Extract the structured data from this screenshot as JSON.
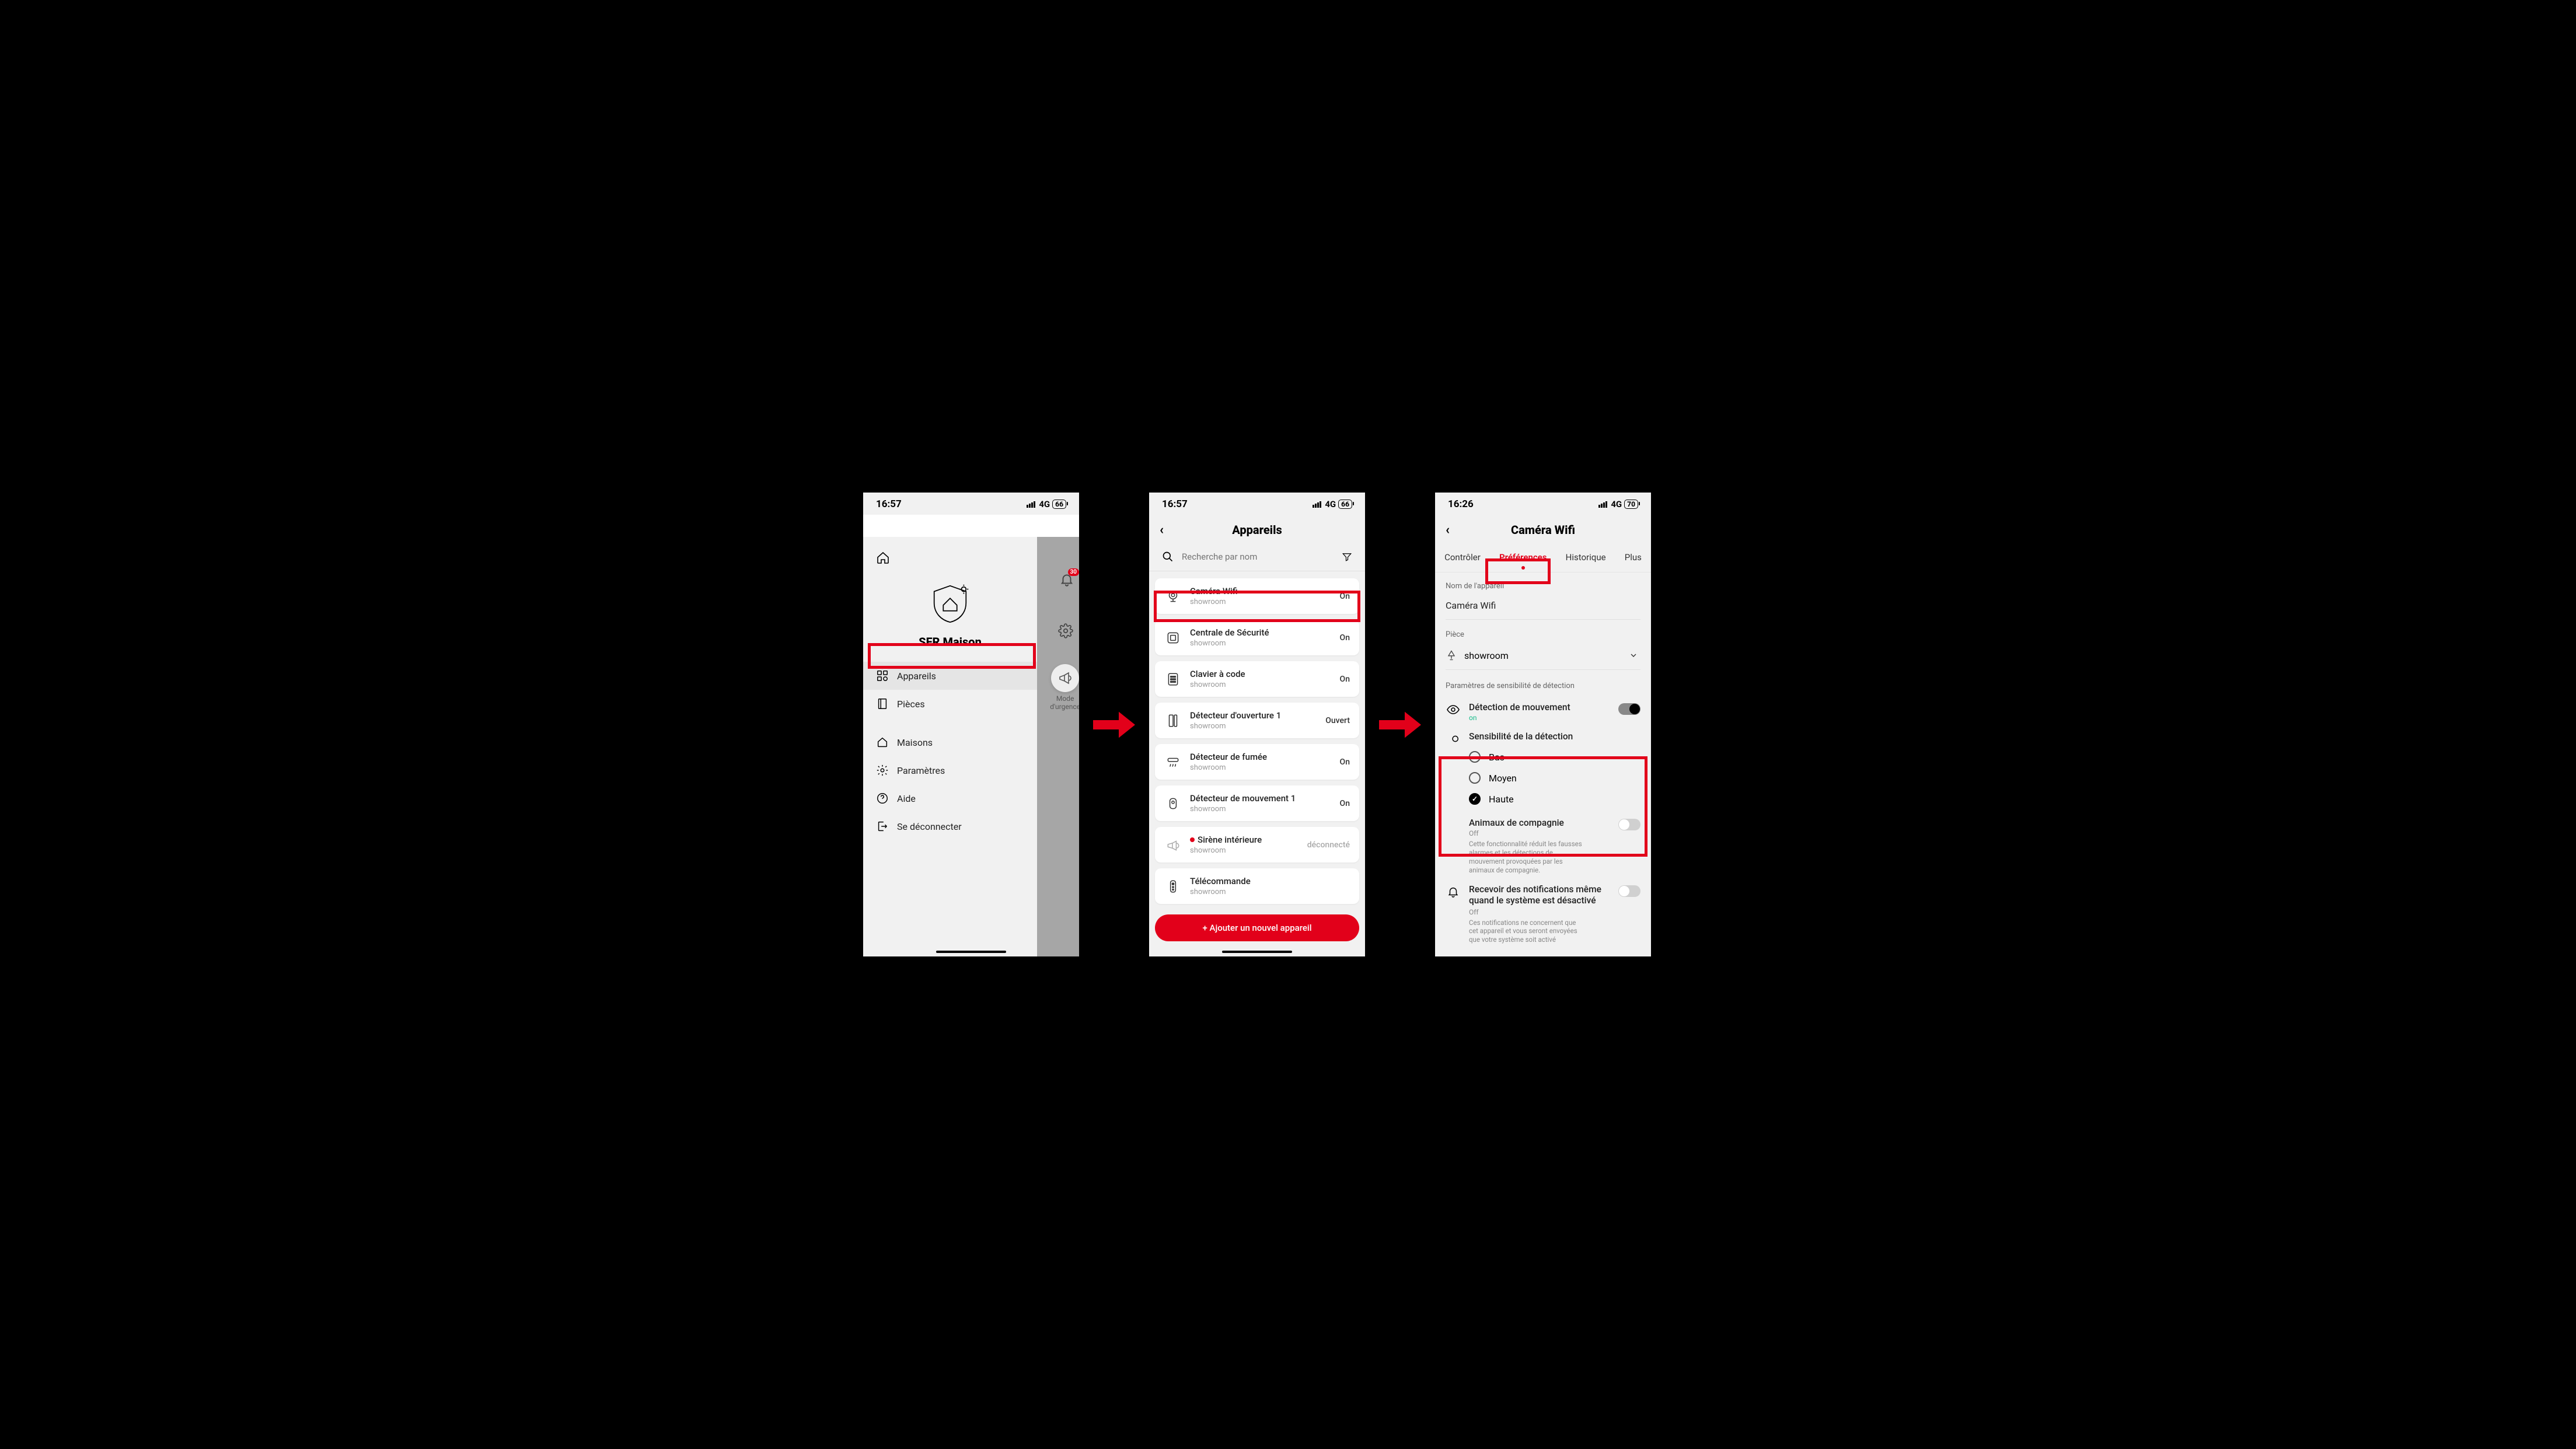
{
  "status": {
    "time1": "16:57",
    "time2": "16:57",
    "time3": "16:26",
    "net": "4G",
    "batt1": "66",
    "batt2": "66",
    "batt3": "70"
  },
  "screen1": {
    "title": "SFR Maison",
    "items": [
      {
        "label": "Appareils",
        "selected": true
      },
      {
        "label": "Pièces"
      },
      {
        "label": "Maisons"
      },
      {
        "label": "Paramètres"
      },
      {
        "label": "Aide"
      },
      {
        "label": "Se déconnecter"
      }
    ],
    "urgence": {
      "l1": "Mode",
      "l2": "d'urgence"
    },
    "badge": "30"
  },
  "screen2": {
    "title": "Appareils",
    "search_placeholder": "Recherche par nom",
    "add": "+ Ajouter un nouvel appareil",
    "devices": [
      {
        "name": "Caméra Wifi",
        "room": "showroom",
        "state": "On",
        "icon": "camera"
      },
      {
        "name": "Centrale de Sécurité",
        "room": "showroom",
        "state": "On",
        "icon": "hub"
      },
      {
        "name": "Clavier à code",
        "room": "showroom",
        "state": "On",
        "icon": "keypad"
      },
      {
        "name": "Détecteur d'ouverture 1",
        "room": "showroom",
        "state": "Ouvert",
        "icon": "door"
      },
      {
        "name": "Détecteur de fumée",
        "room": "showroom",
        "state": "On",
        "icon": "smoke"
      },
      {
        "name": "Détecteur de mouvement 1",
        "room": "showroom",
        "state": "On",
        "icon": "motion"
      },
      {
        "name": "Sirène intérieure",
        "room": "showroom",
        "state": "déconnecté",
        "disconnected": true,
        "icon": "siren",
        "dot": true
      },
      {
        "name": "Télécommande",
        "room": "showroom",
        "state": "",
        "icon": "remote"
      }
    ]
  },
  "screen3": {
    "title": "Caméra Wifi",
    "tabs": [
      "Contrôler",
      "Préférences",
      "Historique",
      "Plus"
    ],
    "active_tab": 1,
    "name_label": "Nom de l'appareil",
    "name_value": "Caméra Wifi",
    "room_label": "Pièce",
    "room_value": "showroom",
    "sens_section": "Paramètres de sensibilité de détection",
    "motion": {
      "title": "Détection de mouvement",
      "state": "on"
    },
    "sens": {
      "title": "Sensibilité de la détection",
      "options": [
        "Bas",
        "Moyen",
        "Haute"
      ],
      "selected": 2
    },
    "pets": {
      "title": "Animaux de compagnie",
      "state": "Off",
      "desc": "Cette fonctionnalité réduit les fausses alarmes et les détections de mouvement provoquées par les animaux de compagnie."
    },
    "notif": {
      "title": "Recevoir des notifications même quand le système est désactivé",
      "state": "Off",
      "desc": "Ces notifications ne concernent que cet appareil et vous seront envoyées que votre système soit activé"
    }
  }
}
